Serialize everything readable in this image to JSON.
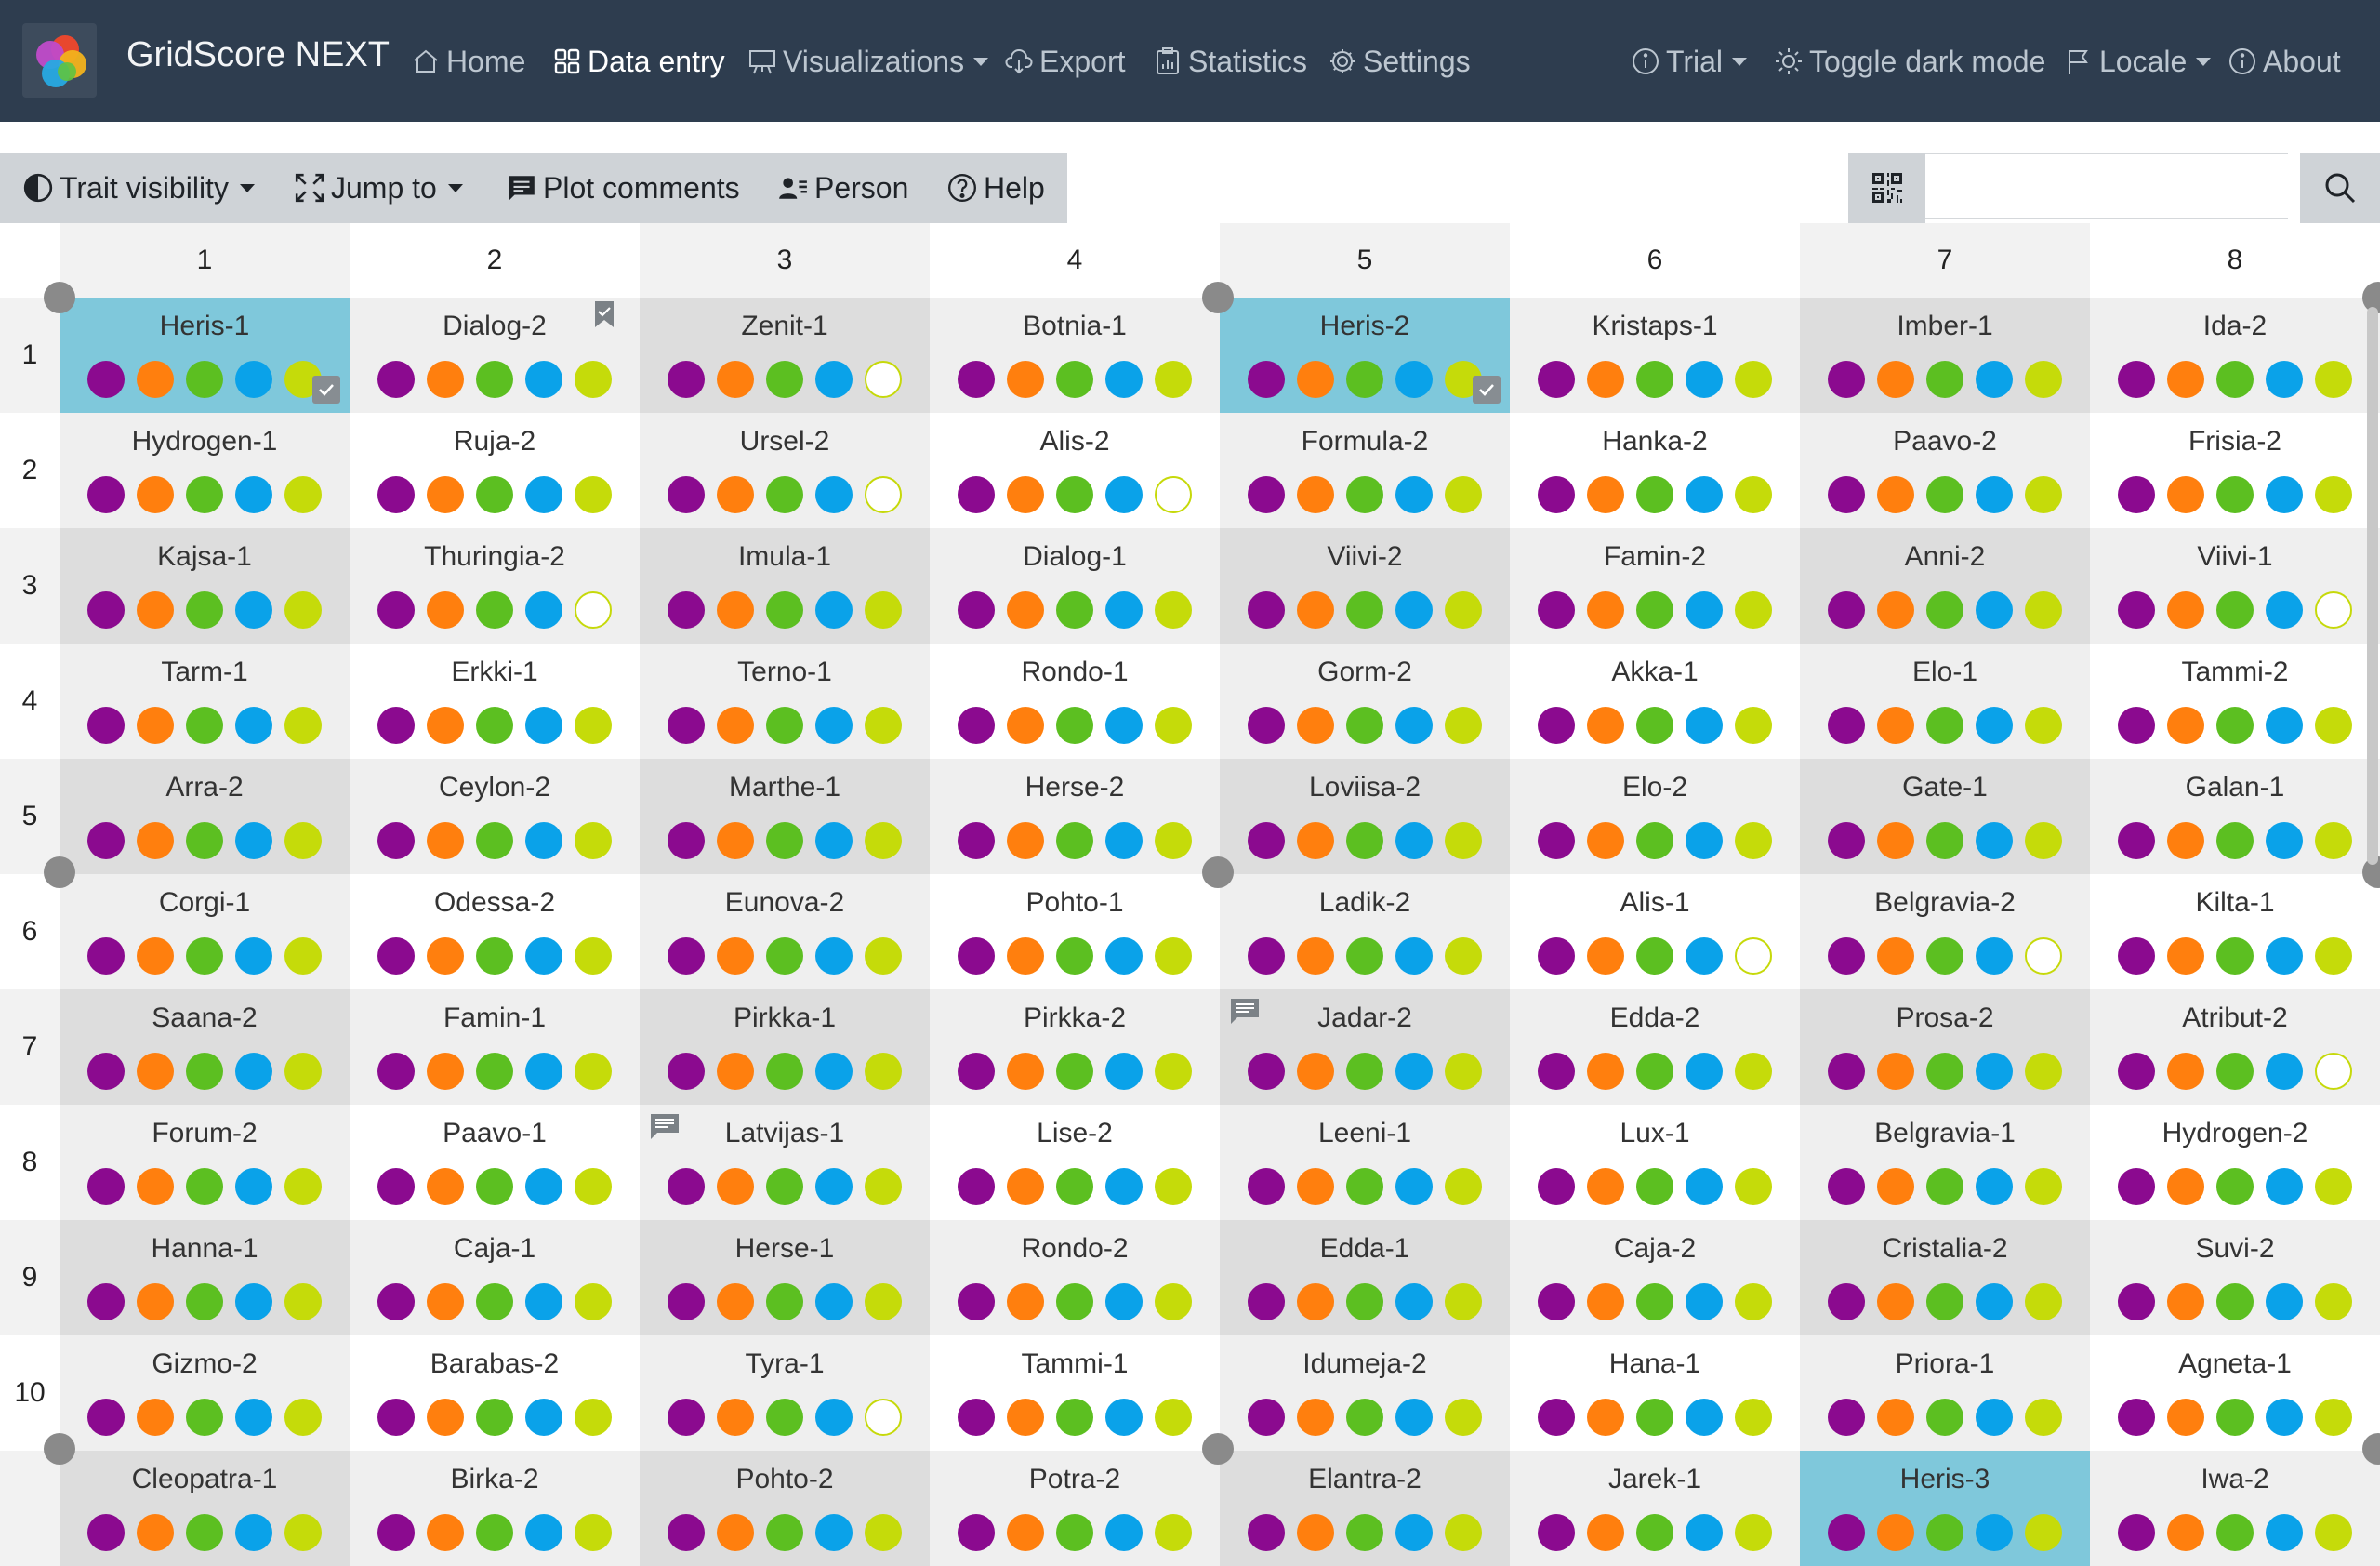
{
  "app": {
    "title": "GridScore NEXT"
  },
  "nav": {
    "home": "Home",
    "data_entry": "Data entry",
    "visualizations": "Visualizations",
    "export": "Export",
    "statistics": "Statistics",
    "settings": "Settings",
    "trial": "Trial",
    "dark_mode": "Toggle dark mode",
    "locale": "Locale",
    "about": "About"
  },
  "toolbar": {
    "trait_visibility": "Trait visibility",
    "jump_to": "Jump to",
    "plot_comments": "Plot comments",
    "person": "Person",
    "help": "Help"
  },
  "search": {
    "value": "",
    "placeholder": ""
  },
  "colors": {
    "navbar": "#2e3d4f",
    "highlight": "#7fc8db",
    "trait_colors": [
      "#8b0a8f",
      "#ff7f0e",
      "#5cbf21",
      "#0aa2e9",
      "#c5db0a"
    ]
  },
  "grid": {
    "columns": [
      "1",
      "2",
      "3",
      "4",
      "5",
      "6",
      "7",
      "8"
    ],
    "rows": [
      {
        "label": "1",
        "cells": [
          {
            "name": "Heris-1",
            "highlight": true,
            "complete": true,
            "empty": []
          },
          {
            "name": "Dialog-2",
            "bookmark": true,
            "empty": []
          },
          {
            "name": "Zenit-1",
            "empty": [
              4
            ]
          },
          {
            "name": "Botnia-1",
            "empty": []
          },
          {
            "name": "Heris-2",
            "highlight": true,
            "complete": true,
            "empty": []
          },
          {
            "name": "Kristaps-1",
            "empty": []
          },
          {
            "name": "Imber-1",
            "empty": []
          },
          {
            "name": "Ida-2",
            "empty": []
          }
        ]
      },
      {
        "label": "2",
        "cells": [
          {
            "name": "Hydrogen-1",
            "empty": []
          },
          {
            "name": "Ruja-2",
            "empty": []
          },
          {
            "name": "Ursel-2",
            "empty": [
              4
            ]
          },
          {
            "name": "Alis-2",
            "empty": [
              4
            ]
          },
          {
            "name": "Formula-2",
            "empty": []
          },
          {
            "name": "Hanka-2",
            "empty": []
          },
          {
            "name": "Paavo-2",
            "empty": []
          },
          {
            "name": "Frisia-2",
            "empty": []
          }
        ]
      },
      {
        "label": "3",
        "cells": [
          {
            "name": "Kajsa-1",
            "empty": []
          },
          {
            "name": "Thuringia-2",
            "empty": [
              4
            ]
          },
          {
            "name": "Imula-1",
            "empty": []
          },
          {
            "name": "Dialog-1",
            "empty": []
          },
          {
            "name": "Viivi-2",
            "empty": []
          },
          {
            "name": "Famin-2",
            "empty": []
          },
          {
            "name": "Anni-2",
            "empty": []
          },
          {
            "name": "Viivi-1",
            "empty": [
              4
            ]
          }
        ]
      },
      {
        "label": "4",
        "cells": [
          {
            "name": "Tarm-1",
            "empty": []
          },
          {
            "name": "Erkki-1",
            "empty": []
          },
          {
            "name": "Terno-1",
            "empty": []
          },
          {
            "name": "Rondo-1",
            "empty": []
          },
          {
            "name": "Gorm-2",
            "empty": []
          },
          {
            "name": "Akka-1",
            "empty": []
          },
          {
            "name": "Elo-1",
            "empty": []
          },
          {
            "name": "Tammi-2",
            "empty": []
          }
        ]
      },
      {
        "label": "5",
        "cells": [
          {
            "name": "Arra-2",
            "empty": []
          },
          {
            "name": "Ceylon-2",
            "empty": []
          },
          {
            "name": "Marthe-1",
            "empty": []
          },
          {
            "name": "Herse-2",
            "empty": []
          },
          {
            "name": "Loviisa-2",
            "empty": []
          },
          {
            "name": "Elo-2",
            "empty": []
          },
          {
            "name": "Gate-1",
            "empty": []
          },
          {
            "name": "Galan-1",
            "empty": []
          }
        ]
      },
      {
        "label": "6",
        "cells": [
          {
            "name": "Corgi-1",
            "empty": []
          },
          {
            "name": "Odessa-2",
            "empty": []
          },
          {
            "name": "Eunova-2",
            "empty": []
          },
          {
            "name": "Pohto-1",
            "empty": []
          },
          {
            "name": "Ladik-2",
            "empty": []
          },
          {
            "name": "Alis-1",
            "empty": [
              4
            ]
          },
          {
            "name": "Belgravia-2",
            "empty": [
              4
            ]
          },
          {
            "name": "Kilta-1",
            "empty": []
          }
        ]
      },
      {
        "label": "7",
        "cells": [
          {
            "name": "Saana-2",
            "empty": []
          },
          {
            "name": "Famin-1",
            "empty": []
          },
          {
            "name": "Pirkka-1",
            "empty": []
          },
          {
            "name": "Pirkka-2",
            "empty": []
          },
          {
            "name": "Jadar-2",
            "comment": true,
            "empty": []
          },
          {
            "name": "Edda-2",
            "empty": []
          },
          {
            "name": "Prosa-2",
            "empty": []
          },
          {
            "name": "Atribut-2",
            "empty": [
              4
            ]
          }
        ]
      },
      {
        "label": "8",
        "cells": [
          {
            "name": "Forum-2",
            "empty": []
          },
          {
            "name": "Paavo-1",
            "empty": []
          },
          {
            "name": "Latvijas-1",
            "comment": true,
            "empty": []
          },
          {
            "name": "Lise-2",
            "empty": []
          },
          {
            "name": "Leeni-1",
            "empty": []
          },
          {
            "name": "Lux-1",
            "empty": []
          },
          {
            "name": "Belgravia-1",
            "empty": []
          },
          {
            "name": "Hydrogen-2",
            "empty": []
          }
        ]
      },
      {
        "label": "9",
        "cells": [
          {
            "name": "Hanna-1",
            "empty": []
          },
          {
            "name": "Caja-1",
            "empty": []
          },
          {
            "name": "Herse-1",
            "empty": []
          },
          {
            "name": "Rondo-2",
            "empty": []
          },
          {
            "name": "Edda-1",
            "empty": []
          },
          {
            "name": "Caja-2",
            "empty": []
          },
          {
            "name": "Cristalia-2",
            "empty": []
          },
          {
            "name": "Suvi-2",
            "empty": []
          }
        ]
      },
      {
        "label": "10",
        "cells": [
          {
            "name": "Gizmo-2",
            "empty": []
          },
          {
            "name": "Barabas-2",
            "empty": []
          },
          {
            "name": "Tyra-1",
            "empty": [
              4
            ]
          },
          {
            "name": "Tammi-1",
            "empty": []
          },
          {
            "name": "Idumeja-2",
            "empty": []
          },
          {
            "name": "Hana-1",
            "empty": []
          },
          {
            "name": "Priora-1",
            "empty": []
          },
          {
            "name": "Agneta-1",
            "empty": []
          }
        ]
      },
      {
        "label": "",
        "cells": [
          {
            "name": "Cleopatra-1",
            "empty": []
          },
          {
            "name": "Birka-2",
            "empty": []
          },
          {
            "name": "Pohto-2",
            "empty": []
          },
          {
            "name": "Potra-2",
            "empty": []
          },
          {
            "name": "Elantra-2",
            "empty": []
          },
          {
            "name": "Jarek-1",
            "empty": []
          },
          {
            "name": "Heris-3",
            "highlight": true,
            "empty": []
          },
          {
            "name": "Iwa-2",
            "empty": []
          }
        ]
      }
    ]
  }
}
